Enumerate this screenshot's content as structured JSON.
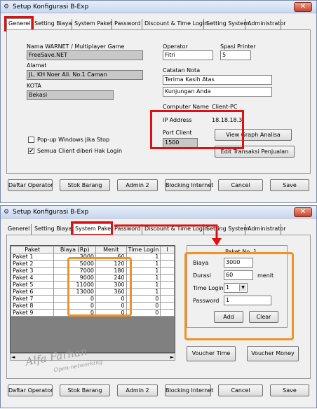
{
  "window_title": "Setup Konfigurasi B-Exp",
  "close_glyph": "✕",
  "tabs": [
    "Generel",
    "Setting Biaya",
    "System Paket",
    "Password",
    "Discount & Time Login",
    "Setting System",
    "Administrator"
  ],
  "general": {
    "nama_label": "Nama WARNET / Multiplayer Game",
    "nama_value": "FreeSave.NET",
    "alamat_label": "Alamat",
    "alamat_value": "JL. KH Noer Ali. No.1 Caman",
    "kota_label": "KOTA",
    "kota_value": "Bekasi",
    "operator_label": "Operator",
    "operator_value": "Fitri",
    "spasi_label": "Spasi Printer",
    "spasi_value": "5",
    "catatan_label": "Catatan Nota",
    "catatan_1": "Terima Kasih Atas",
    "catatan_2": "Kunjungan Anda",
    "computer_name_label": "Computer Name",
    "computer_name_value": "Client-PC",
    "ip_label": "IP Address",
    "ip_value": "18.18.18.3",
    "port_label": "Port Client",
    "port_value": "1500",
    "view_graph": "View Graph Analisa",
    "edit_transaksi": "Edit Transaksi Penjualan",
    "popup_label": "Pop-up Windows Jika Stop",
    "popup_checked": false,
    "semua_label": "Semua Client diberi Hak Login",
    "semua_checked": true,
    "check_glyph": "✔"
  },
  "bottom_buttons": [
    "Daftar Operator",
    "Stok Barang",
    "Admin 2",
    "Blocking Internet",
    "Cancel",
    "Save"
  ],
  "paket": {
    "headers": [
      "Paket",
      "Biaya (Rp)",
      "Menit",
      "Time Login",
      "I"
    ],
    "rows": [
      [
        "Paket 1",
        "3000",
        "60",
        "1",
        ""
      ],
      [
        "Paket 2",
        "5000",
        "120",
        "1",
        ""
      ],
      [
        "Paket 3",
        "7000",
        "180",
        "1",
        ""
      ],
      [
        "Paket 4",
        "9000",
        "240",
        "1",
        ""
      ],
      [
        "Paket 5",
        "11000",
        "300",
        "1",
        ""
      ],
      [
        "Paket 6",
        "13000",
        "360",
        "1",
        ""
      ],
      [
        "Paket 7",
        "0",
        "0",
        "0",
        ""
      ],
      [
        "Paket 8",
        "0",
        "0",
        "0",
        ""
      ],
      [
        "Paket 9",
        "0",
        "0",
        "0",
        ""
      ]
    ],
    "panel_title": "Paket No. 1",
    "biaya_label": "Biaya",
    "biaya_value": "3000",
    "durasi_label": "Durasi",
    "durasi_value": "60",
    "menit_label": "menit",
    "time_login_label": "Time Login",
    "time_login_value": "1",
    "password_label": "Password",
    "password_value": "1",
    "add_label": "Add",
    "clear_label": "Clear",
    "voucher_time": "Voucher Time",
    "voucher_money": "Voucher Money",
    "scroll_left": "◄",
    "scroll_right": "►",
    "dropdown_glyph": "▼"
  },
  "watermark": {
    "line1": "Alfa Farhan",
    "line2": "Open-networking"
  },
  "colors": {
    "highlight_red": "#e01010",
    "highlight_orange": "#f0922a",
    "close_red": "#c4452c"
  }
}
